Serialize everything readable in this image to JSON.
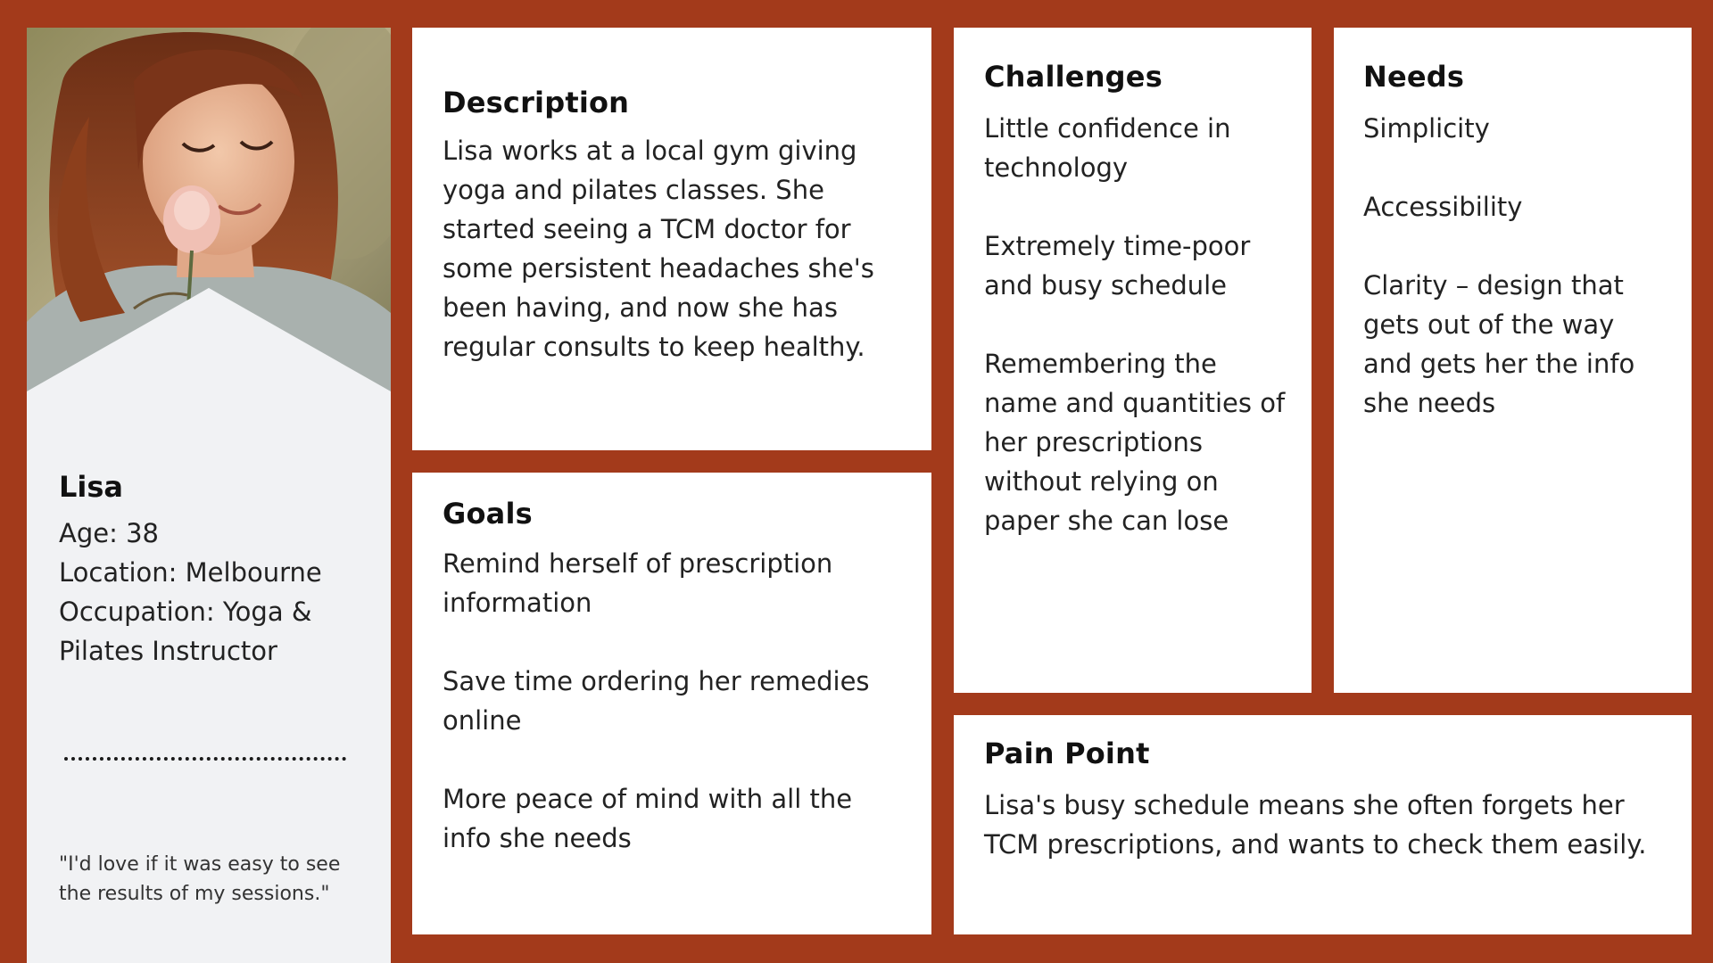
{
  "profile": {
    "name": "Lisa",
    "age": "Age: 38",
    "location": "Location: Melbourne",
    "occupation": "Occupation: Yoga & Pilates Instructor",
    "quote": "\"I'd love if it was easy to see the results of my sessions.\""
  },
  "description": {
    "title": "Description",
    "body": "Lisa works at a local gym giving yoga and pilates classes. She started seeing a TCM doctor for some persistent headaches she's been having, and now she has regular consults to keep healthy."
  },
  "goals": {
    "title": "Goals",
    "items": [
      "Remind herself of prescription information",
      "Save time ordering her remedies online",
      "More peace of mind with all the info she needs"
    ]
  },
  "challenges": {
    "title": "Challenges",
    "items": [
      "Little confidence in technology",
      "Extremely time-poor and busy schedule",
      "Remembering the name and quantities of her prescriptions without relying on paper she can lose"
    ]
  },
  "needs": {
    "title": "Needs",
    "items": [
      "Simplicity",
      "Accessibility",
      "Clarity – design that gets out of the way and gets her the info she needs"
    ]
  },
  "pain_point": {
    "title": "Pain Point",
    "body": "Lisa's busy schedule means she often forgets her TCM prescriptions, and wants to check them easily."
  },
  "colors": {
    "background": "#a33a1b",
    "card": "#ffffff",
    "profile_panel": "#f1f2f4"
  }
}
